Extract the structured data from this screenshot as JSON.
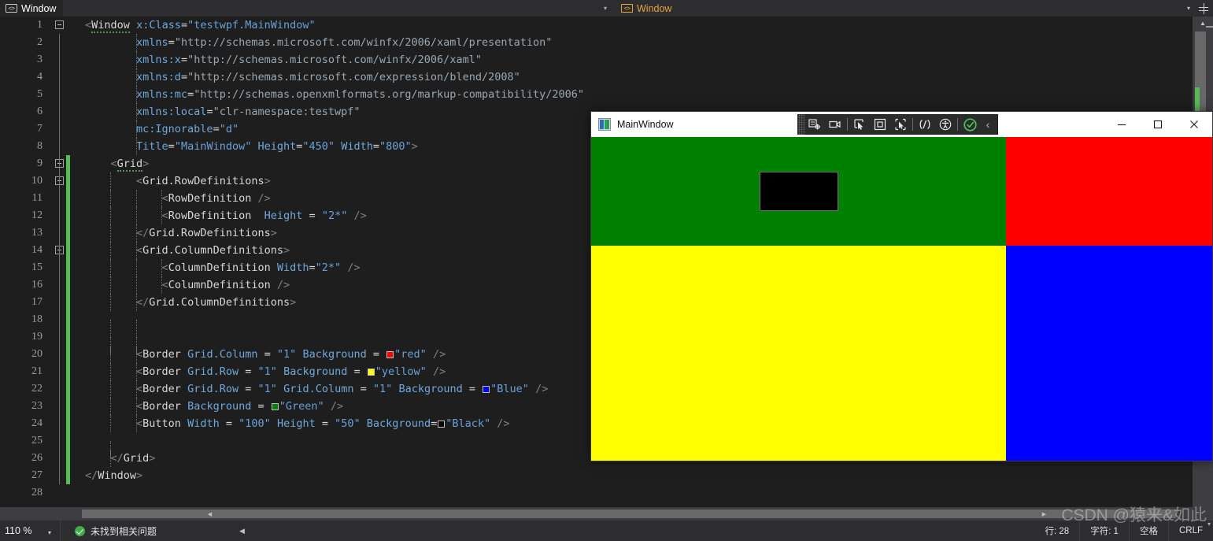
{
  "tabs": {
    "left": {
      "label": "Window",
      "icon": "xml-document-icon"
    },
    "right": {
      "label": "Window",
      "icon": "xml-document-icon"
    },
    "caret": "▾",
    "split_icon": "split-window-icon"
  },
  "editor": {
    "lines": [
      {
        "n": "1",
        "fold": true,
        "text": "<Window x:Class=\"testwpf.MainWindow\""
      },
      {
        "n": "2",
        "fold": false,
        "text": "        xmlns=\"http://schemas.microsoft.com/winfx/2006/xaml/presentation\""
      },
      {
        "n": "3",
        "fold": false,
        "text": "        xmlns:x=\"http://schemas.microsoft.com/winfx/2006/xaml\""
      },
      {
        "n": "4",
        "fold": false,
        "text": "        xmlns:d=\"http://schemas.microsoft.com/expression/blend/2008\""
      },
      {
        "n": "5",
        "fold": false,
        "text": "        xmlns:mc=\"http://schemas.openxmlformats.org/markup-compatibility/2006\""
      },
      {
        "n": "6",
        "fold": false,
        "text": "        xmlns:local=\"clr-namespace:testwpf\""
      },
      {
        "n": "7",
        "fold": false,
        "text": "        mc:Ignorable=\"d\""
      },
      {
        "n": "8",
        "fold": false,
        "text": "        Title=\"MainWindow\" Height=\"450\" Width=\"800\">"
      },
      {
        "n": "9",
        "fold": true,
        "text": "    <Grid>"
      },
      {
        "n": "10",
        "fold": true,
        "text": "        <Grid.RowDefinitions>"
      },
      {
        "n": "11",
        "fold": false,
        "text": "            <RowDefinition />"
      },
      {
        "n": "12",
        "fold": false,
        "text": "            <RowDefinition  Height = \"2*\" />"
      },
      {
        "n": "13",
        "fold": false,
        "text": "        </Grid.RowDefinitions>"
      },
      {
        "n": "14",
        "fold": true,
        "text": "        <Grid.ColumnDefinitions>"
      },
      {
        "n": "15",
        "fold": false,
        "text": "            <ColumnDefinition Width=\"2*\" />"
      },
      {
        "n": "16",
        "fold": false,
        "text": "            <ColumnDefinition />"
      },
      {
        "n": "17",
        "fold": false,
        "text": "        </Grid.ColumnDefinitions>"
      },
      {
        "n": "18",
        "fold": false,
        "text": ""
      },
      {
        "n": "19",
        "fold": false,
        "text": ""
      },
      {
        "n": "20",
        "fold": false,
        "text": "        <Border Grid.Column = \"1\" Background = \"red\" />"
      },
      {
        "n": "21",
        "fold": false,
        "text": "        <Border Grid.Row = \"1\" Background = \"yellow\" />"
      },
      {
        "n": "22",
        "fold": false,
        "text": "        <Border Grid.Row = \"1\" Grid.Column = \"1\" Background = \"Blue\" />"
      },
      {
        "n": "23",
        "fold": false,
        "text": "        <Border Background = \"Green\" />"
      },
      {
        "n": "24",
        "fold": false,
        "text": "        <Button Width = \"100\" Height = \"50\" Background=\"Black\" />"
      },
      {
        "n": "25",
        "fold": false,
        "text": ""
      },
      {
        "n": "26",
        "fold": false,
        "text": "    </Grid>"
      },
      {
        "n": "27",
        "fold": false,
        "text": "</Window>"
      },
      {
        "n": "28",
        "fold": false,
        "text": ""
      }
    ],
    "colors": {
      "background": "#1e1e1e",
      "tag": "#d8d8d8",
      "attribute": "#6fa8dc",
      "string": "#6aa0d8",
      "punctuation": "#808080",
      "change_bar": "#57b957"
    }
  },
  "mainwindow": {
    "title": "MainWindow",
    "app_icon": "wpf-app-icon",
    "toolbar": {
      "grip": "drag-grip",
      "buttons": [
        {
          "name": "go-to-live-visual-tree-icon",
          "label": ""
        },
        {
          "name": "live-visual-tree-camera-icon",
          "label": ""
        },
        {
          "name": "enable-selection-icon",
          "label": ""
        },
        {
          "name": "display-layout-adorner-icon",
          "label": ""
        },
        {
          "name": "track-focused-element-icon",
          "label": ""
        },
        {
          "name": "xaml-hot-reload-icon",
          "label": ""
        },
        {
          "name": "accessibility-icon",
          "label": ""
        },
        {
          "name": "hot-reload-status-icon",
          "label": ""
        },
        {
          "name": "collapse-toolbar-chevron-icon",
          "label": "‹"
        }
      ]
    },
    "window_buttons": {
      "minimize": "—",
      "maximize": "▢",
      "close": "✕"
    },
    "grid": {
      "row_definitions": [
        "1*",
        "2*"
      ],
      "column_definitions": [
        "2*",
        "1*"
      ],
      "cells": [
        {
          "name": "green-border",
          "color": "#008000",
          "row": 0,
          "column": 0
        },
        {
          "name": "red-border",
          "color": "#ff0000",
          "row": 0,
          "column": 1
        },
        {
          "name": "yellow-border",
          "color": "#ffff00",
          "row": 1,
          "column": 0
        },
        {
          "name": "blue-border",
          "color": "#0000ff",
          "row": 1,
          "column": 1
        }
      ],
      "button": {
        "name": "black-button",
        "color": "#000000",
        "width": "100",
        "height": "50",
        "label": ""
      }
    }
  },
  "statusbar": {
    "zoom": "110 %",
    "zoom_caret": "▾",
    "issue_status": "未找到相关问题",
    "issue_icon": "success-check-icon",
    "collapse_caret": "◀",
    "line": "行: 28",
    "column": "字符: 1",
    "indent": "空格",
    "line_ending": "CRLF"
  },
  "watermark": {
    "text": "CSDN @猿来&如此"
  }
}
